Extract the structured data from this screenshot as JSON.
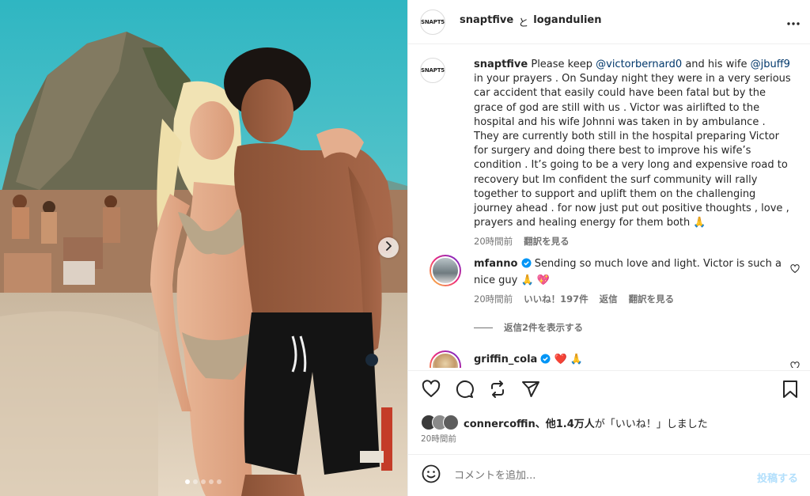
{
  "post": {
    "author": "snaptfive",
    "collab_joiner": "と",
    "collaborator": "logandulien",
    "logo_text": "SNAPT5"
  },
  "icons": {
    "more": "more-horizontal-icon",
    "next": "chevron-right-icon",
    "like": "heart-icon",
    "comment": "comment-icon",
    "repost": "repost-icon",
    "share": "send-icon",
    "save": "bookmark-icon",
    "emoji": "smiley-icon",
    "verified": "verified-badge-icon"
  },
  "caption": {
    "username": "snaptfive",
    "part1": " Please keep ",
    "mention1": "@victorbernard0",
    "part2": " and his wife ",
    "mention2": "@jbuff9",
    "part3": " in your prayers . On Sunday night they were in a very serious car accident that easily could have been fatal but by the grace of god are still with us . Victor was airlifted to the hospital and his wife Johnni was taken in by ambulance . They are currently both still in the hospital preparing Victor for surgery and doing there best to improve his wife’s condition . It’s going to be a very long and expensive road to recovery but Im confident the surf community will rally together to support and uplift them on the challenging journey ahead . for now just put out positive thoughts , love , prayers and healing energy for them both ",
    "emoji": "🙏",
    "time": "20時間前",
    "translate": "翻訳を見る"
  },
  "comments": [
    {
      "username": "mfanno",
      "text": " Sending so much love and light. Victor is such a nice guy ",
      "emojis": "🙏 💖",
      "time": "20時間前",
      "likes": "いいね！197件",
      "reply": "返信",
      "translate": "翻訳を見る",
      "view_replies": "返信2件を表示する"
    },
    {
      "username": "griffin_cola",
      "text": " ",
      "emojis": "❤️ 🙏"
    }
  ],
  "likes": {
    "first_liker": "connercoffin",
    "others": "、他1.4万人",
    "suffix": "が「いいね！」しました"
  },
  "post_time": "20時間前",
  "composer": {
    "placeholder": "コメントを追加...",
    "post_label": "投稿する"
  },
  "carousel": {
    "slide_count": 5,
    "active_index": 0
  },
  "colors": {
    "link": "#00376b",
    "muted": "#737373",
    "post_button": "#b2dffc",
    "verified": "#0095f6"
  }
}
